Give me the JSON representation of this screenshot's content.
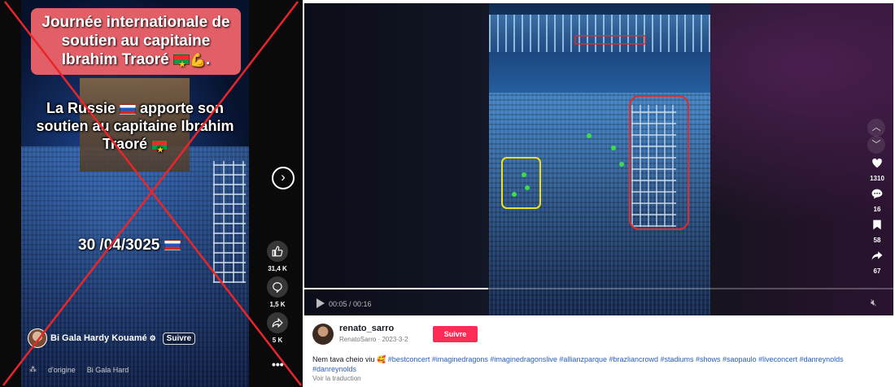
{
  "left_post": {
    "title_banner": "Journée internationale de soutien au capitaine Ibrahim Traoré",
    "subtitle_line1": "La Russie",
    "subtitle_line2": "apporte son soutien au capitaine Ibrahim Traoré",
    "date_text": "30 /04/3025",
    "actions": {
      "likes": "31,4 K",
      "comments": "1,5 K",
      "shares": "5 K"
    },
    "author": "Bi Gala Hardy Kouamé",
    "follow_label": "Suivre",
    "bottom_text_1": "d'origine",
    "bottom_text_2": "Bi Gala Hard",
    "more_label": "•••",
    "false_mark_color": "#e8262a"
  },
  "right_post": {
    "player": {
      "time": "00:05 / 00:16",
      "progress": 0.3125
    },
    "actions": {
      "likes": "1310",
      "comments": "16",
      "saves": "58",
      "shares": "67"
    },
    "author": {
      "username": "renato_sarro",
      "meta": "RenatoSarro · 2023-3-2"
    },
    "follow_label": "Suivre",
    "caption_text": "Nem tava cheio viu",
    "caption_emoji": "🥰",
    "hashtags": "#bestconcert #imaginedragons #imaginedragonslive #allianzparque #brazliancrowd #stadiums #shows #saopaulo #liveconcert #danreynolds #danreynolds",
    "translate_label": "Voir la traduction",
    "highlight_colors": {
      "yellow": "#f2e01b",
      "red": "#e32a2a"
    },
    "accent_color": "#fe2c55"
  }
}
